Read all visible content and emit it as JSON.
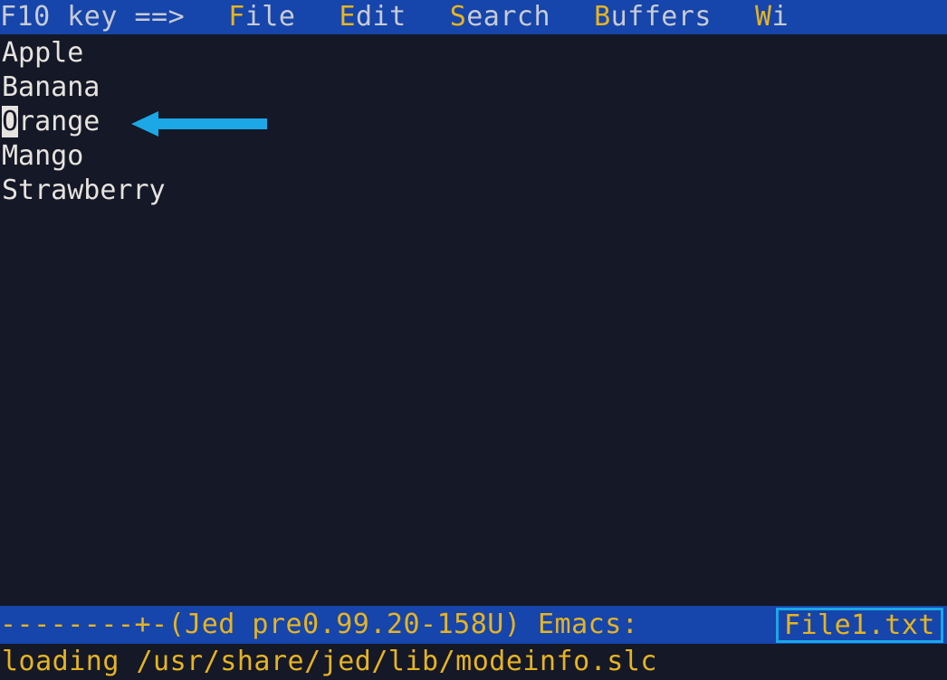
{
  "menu": {
    "hint": "F10 key ==>",
    "items": [
      {
        "key": "F",
        "rest": "ile"
      },
      {
        "key": "E",
        "rest": "dit"
      },
      {
        "key": "S",
        "rest": "earch"
      },
      {
        "key": "B",
        "rest": "uffers"
      },
      {
        "key": "W",
        "rest": "i"
      }
    ]
  },
  "editor": {
    "lines": [
      {
        "text": "Apple",
        "cursor_col": null
      },
      {
        "text": "Banana",
        "cursor_col": null
      },
      {
        "text": "Orange",
        "cursor_col": 0
      },
      {
        "text": "Mango",
        "cursor_col": null
      },
      {
        "text": "Strawberry",
        "cursor_col": null
      }
    ]
  },
  "status": {
    "left": "--------+-(Jed pre0.99.20-158U)",
    "mode": "Emacs:",
    "filename": "File1.txt"
  },
  "minibuffer": {
    "text": "loading /usr/share/jed/lib/modeinfo.slc"
  }
}
